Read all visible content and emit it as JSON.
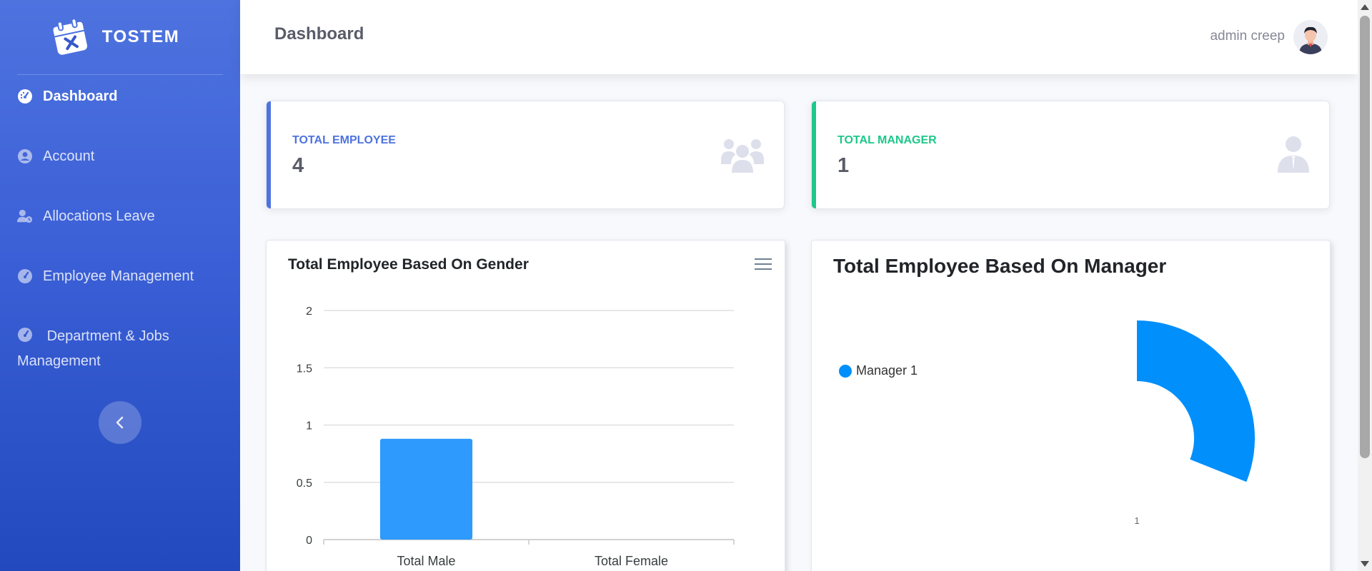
{
  "brand": {
    "name": "TOSTEM"
  },
  "sidebar": {
    "items": [
      {
        "label": "Dashboard",
        "icon": "tachometer-icon",
        "active": true
      },
      {
        "label": "Account",
        "icon": "user-circle-icon",
        "active": false
      },
      {
        "label": "Allocations Leave",
        "icon": "user-clock-icon",
        "active": false
      },
      {
        "label": "Employee Management",
        "icon": "tachometer-icon",
        "active": false
      },
      {
        "label": "Department & Jobs Management",
        "icon": "tachometer-icon",
        "active": false
      }
    ],
    "toggle_icon": "chevron-left-icon"
  },
  "topbar": {
    "title": "Dashboard",
    "user_name": "admin creep"
  },
  "cards": [
    {
      "label": "TOTAL EMPLOYEE",
      "value": "4",
      "icon": "users-icon",
      "color": "#4e73df"
    },
    {
      "label": "TOTAL MANAGER",
      "value": "1",
      "icon": "user-tie-icon",
      "color": "#1cc88a"
    }
  ],
  "charts": {
    "gender_title": "Total Employee Based On Gender",
    "manager_title": "Total Employee Based On Manager"
  },
  "chart_data": [
    {
      "type": "bar",
      "title": "Total Employee Based On Gender",
      "categories": [
        "Total Male",
        "Total Female"
      ],
      "values": [
        0.88,
        0
      ],
      "ylim": [
        0,
        2
      ],
      "yticks": [
        "2",
        "1.5",
        "1",
        "0.5",
        "0"
      ],
      "grid": true,
      "color": "#2e9afe"
    },
    {
      "type": "pie",
      "title": "Total Employee Based On Manager",
      "labels": [
        "Manager 1"
      ],
      "values": [
        1
      ],
      "legend": "left",
      "data_label": "1",
      "color": "#008ffb"
    }
  ]
}
